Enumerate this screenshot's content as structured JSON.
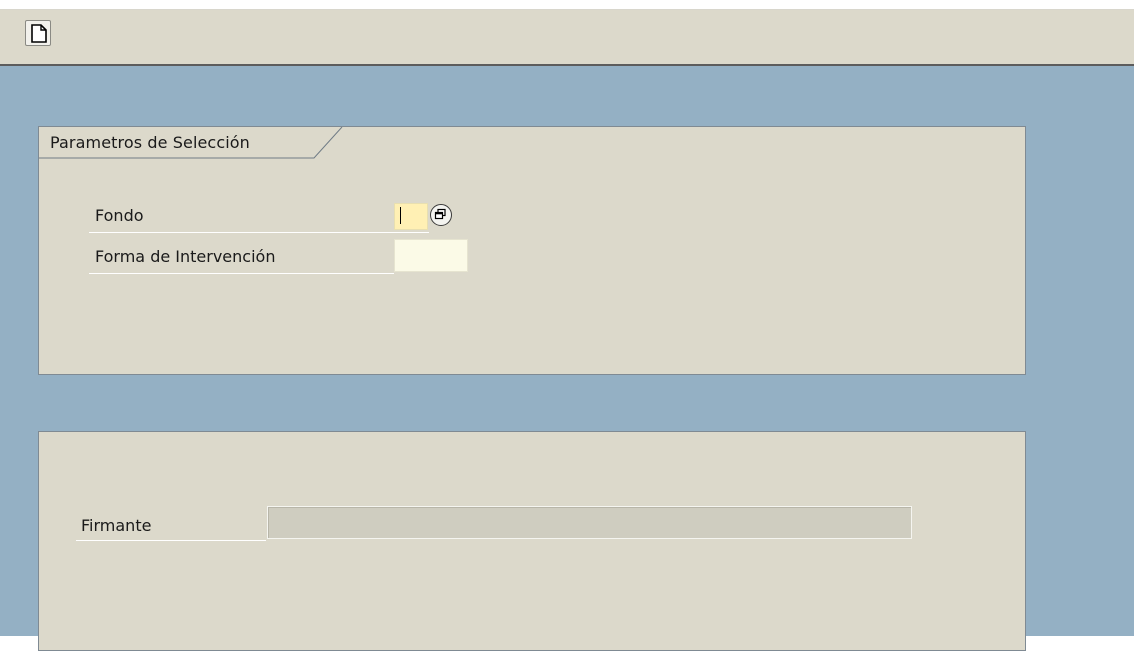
{
  "toolbar": {
    "new_icon": "new-document-icon"
  },
  "selection_group": {
    "title": "Parametros de Selección",
    "fields": [
      {
        "label": "Fondo",
        "value": "",
        "help_icon": "value-help-icon"
      },
      {
        "label": "Forma de Intervención",
        "value": ""
      }
    ]
  },
  "signer_group": {
    "fields": [
      {
        "label": "Firmante",
        "value": ""
      }
    ]
  },
  "colors": {
    "toolbar_bg": "#dcd9cb",
    "workarea_bg": "#94b0c4",
    "group_bg": "#dcd9cb",
    "focused_input_bg": "#fff0b4",
    "readonly_input_bg": "#cfcdc0"
  }
}
